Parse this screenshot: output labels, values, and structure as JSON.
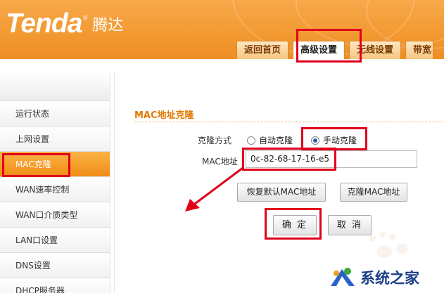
{
  "header": {
    "brand": "Tenda",
    "brand_mark": "®",
    "brand_cn": "腾达",
    "tabs": [
      {
        "label": "返回首页",
        "active": false
      },
      {
        "label": "高级设置",
        "active": true
      },
      {
        "label": "无线设置",
        "active": false
      },
      {
        "label": "带宽",
        "active": false
      }
    ]
  },
  "sidebar": {
    "items": [
      {
        "label": "运行状态"
      },
      {
        "label": "上网设置"
      },
      {
        "label": "MAC克隆",
        "active": true
      },
      {
        "label": "WAN速率控制"
      },
      {
        "label": "WAN口介质类型"
      },
      {
        "label": "LAN口设置"
      },
      {
        "label": "DNS设置"
      },
      {
        "label": "DHCP服务器"
      }
    ]
  },
  "main": {
    "title": "MAC地址克隆",
    "clone_mode_label": "克隆方式",
    "auto_clone_label": "自动克隆",
    "manual_clone_label": "手动克隆",
    "clone_mode_selected": "手动克隆",
    "mac_label": "MAC地址",
    "mac_value": "0c-82-68-17-16-e5",
    "restore_default_button": "恢复默认MAC地址",
    "clone_mac_button": "克隆MAC地址",
    "ok_button": "确 定",
    "cancel_button": "取 消"
  },
  "watermark": {
    "text": "系统之家"
  },
  "colors": {
    "header_orange": "#f39a33",
    "section_title": "#e07800",
    "highlight_red": "#e0001b",
    "sidebar_active": "#f08d16"
  }
}
